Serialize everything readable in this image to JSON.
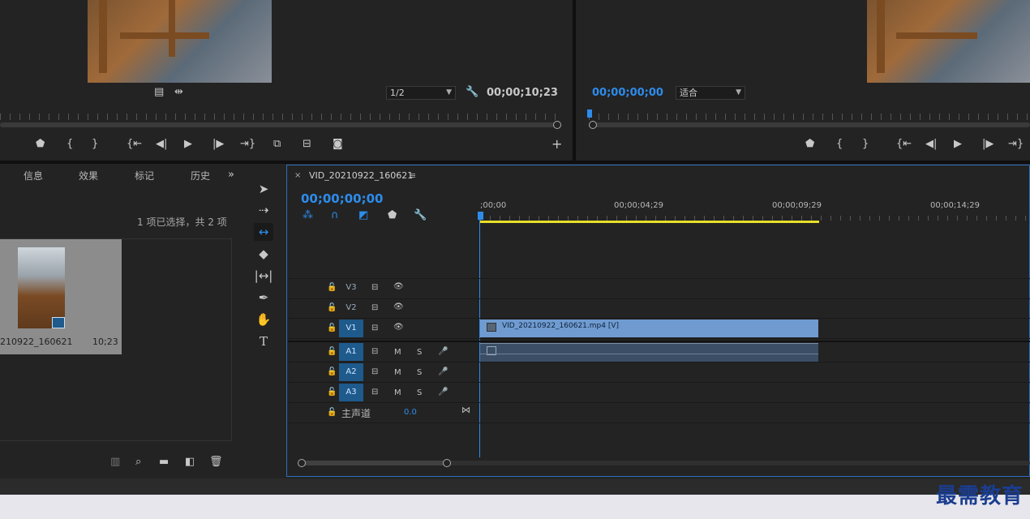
{
  "source_monitor": {
    "scale": "1/2",
    "timecode": "00;00;10;23"
  },
  "program_monitor": {
    "timecode": "00;00;00;00",
    "zoom": "适合"
  },
  "project_panel": {
    "tabs": [
      "信息",
      "效果",
      "标记",
      "历史"
    ],
    "selection_text": "1 项已选择，共 2 项",
    "item": {
      "name": "210922_160621",
      "duration": "10;23"
    }
  },
  "timeline": {
    "sequence_name": "VID_20210922_160621",
    "timecode": "00;00;00;00",
    "ruler_labels": [
      ";00;00",
      "00;00;04;29",
      "00;00;09;29",
      "00;00;14;29"
    ],
    "video_tracks": [
      "V3",
      "V2",
      "V1"
    ],
    "audio_tracks": [
      "A1",
      "A2",
      "A3"
    ],
    "mute_label": "M",
    "solo_label": "S",
    "master_label": "主声道",
    "master_value": "0.0",
    "clip_label": "VID_20210922_160621.mp4 [V]"
  },
  "watermark": "最需教育",
  "colors": {
    "accent_blue": "#2d8ceb",
    "clip_video": "#6f9bd0",
    "clip_audio": "#3b4e66",
    "work_area": "#e8e028"
  }
}
